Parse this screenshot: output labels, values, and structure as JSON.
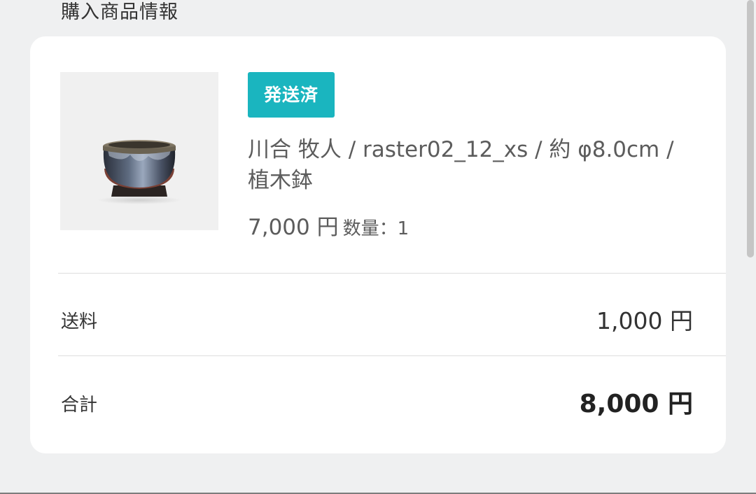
{
  "section": {
    "title": "購入商品情報"
  },
  "product": {
    "image_icon": "bonsai-pot-image",
    "status_badge": "発送済",
    "name": "川合 牧人 / raster02_12_xs / 約 φ8.0cm / 植木鉢",
    "price": "7,000 円",
    "quantity": "数量：1"
  },
  "summary": {
    "shipping_label": "送料",
    "shipping_value": "1,000 円",
    "total_label": "合計",
    "total_value": "8,000 円"
  },
  "colors": {
    "badge": "#1ab5bf",
    "background": "#eff0f1",
    "card": "#ffffff"
  }
}
